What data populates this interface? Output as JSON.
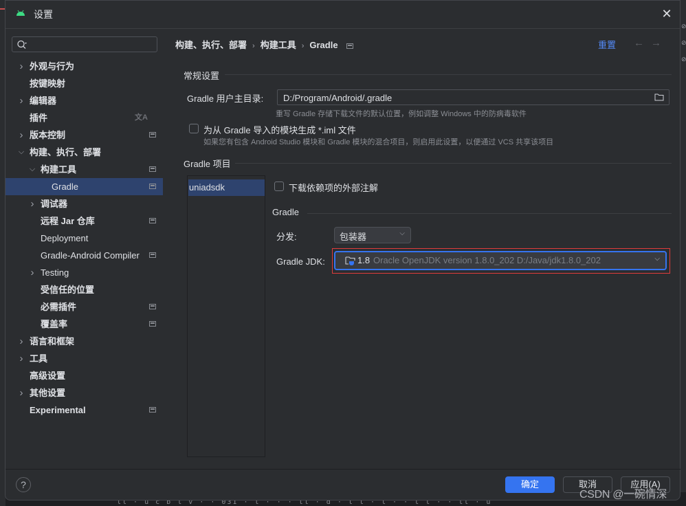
{
  "window": {
    "title": "设置",
    "close_icon": "close-icon",
    "app_icon": "android-icon"
  },
  "sidebar": {
    "search": {
      "placeholder": "",
      "value": "",
      "icon": "search-icon"
    },
    "items": [
      {
        "label": "外观与行为",
        "expandable": true,
        "expanded": false,
        "level": 0,
        "badge": false
      },
      {
        "label": "按键映射",
        "expandable": false,
        "level": 0,
        "badge": false
      },
      {
        "label": "编辑器",
        "expandable": true,
        "expanded": false,
        "level": 0,
        "badge": false
      },
      {
        "label": "插件",
        "expandable": false,
        "level": 0,
        "badge": false,
        "translate_icon": true
      },
      {
        "label": "版本控制",
        "expandable": true,
        "expanded": false,
        "level": 0,
        "badge": true
      },
      {
        "label": "构建、执行、部署",
        "expandable": true,
        "expanded": true,
        "level": 0,
        "badge": false
      },
      {
        "label": "构建工具",
        "expandable": true,
        "expanded": true,
        "level": 1,
        "badge": true
      },
      {
        "label": "Gradle",
        "expandable": false,
        "level": 2,
        "badge": true,
        "selected": true
      },
      {
        "label": "调试器",
        "expandable": true,
        "expanded": false,
        "level": 1,
        "badge": false
      },
      {
        "label": "远程 Jar 仓库",
        "expandable": false,
        "level": 1,
        "badge": true
      },
      {
        "label": "Deployment",
        "expandable": false,
        "level": 1,
        "badge": false
      },
      {
        "label": "Gradle-Android Compiler",
        "expandable": false,
        "level": 1,
        "badge": true
      },
      {
        "label": "Testing",
        "expandable": true,
        "expanded": false,
        "level": 1,
        "badge": false
      },
      {
        "label": "受信任的位置",
        "expandable": false,
        "level": 1,
        "badge": false
      },
      {
        "label": "必需插件",
        "expandable": false,
        "level": 1,
        "badge": true
      },
      {
        "label": "覆盖率",
        "expandable": false,
        "level": 1,
        "badge": true
      },
      {
        "label": "语言和框架",
        "expandable": true,
        "expanded": false,
        "level": 0,
        "badge": false
      },
      {
        "label": "工具",
        "expandable": true,
        "expanded": false,
        "level": 0,
        "badge": false
      },
      {
        "label": "高级设置",
        "expandable": false,
        "level": 0,
        "badge": false
      },
      {
        "label": "其他设置",
        "expandable": true,
        "expanded": false,
        "level": 0,
        "badge": false
      },
      {
        "label": "Experimental",
        "expandable": false,
        "level": 0,
        "badge": true
      }
    ]
  },
  "header": {
    "breadcrumb": [
      "构建、执行、部署",
      "构建工具",
      "Gradle"
    ],
    "reset_label": "重置",
    "back_icon": "←",
    "forward_icon": "→"
  },
  "general": {
    "section_title": "常规设置",
    "user_home_label": "Gradle 用户主目录:",
    "user_home_value": "D:/Program/Android/.gradle",
    "user_home_hint": "重写 Gradle 存储下载文件的默认位置，例如调整 Windows 中的防病毒软件",
    "iml_checkbox_label": "为从 Gradle 导入的模块生成 *.iml 文件",
    "iml_checked": false,
    "iml_hint": "如果您有包含 Android Studio 模块和 Gradle 模块的混合项目，则启用此设置，以便通过 VCS 共享该项目"
  },
  "projects": {
    "section_title": "Gradle 项目",
    "items": [
      "uniadsdk"
    ],
    "selected": "uniadsdk",
    "download_annotations_label": "下载依赖项的外部注解",
    "download_annotations_checked": false,
    "gradle_section_title": "Gradle",
    "distribution_label": "分发:",
    "distribution_value": "包装器",
    "jdk_label": "Gradle JDK:",
    "jdk_version": "1.8",
    "jdk_description": "Oracle OpenJDK version 1.8.0_202 D:/Java/jdk1.8.0_202"
  },
  "footer": {
    "help_label": "?",
    "ok_label": "确定",
    "cancel_label": "取消",
    "apply_label": "应用(A)"
  },
  "watermark": "CSDN @一碗情深",
  "background_text": "ll · u   c   b   l   v  · · 031 · l ·  · · ll · d · l l · l   · · l l · · ll · u",
  "colors": {
    "accent": "#3574f0",
    "selection": "#2e436e",
    "link": "#548af7",
    "highlight_outline": "#e03c3c"
  }
}
